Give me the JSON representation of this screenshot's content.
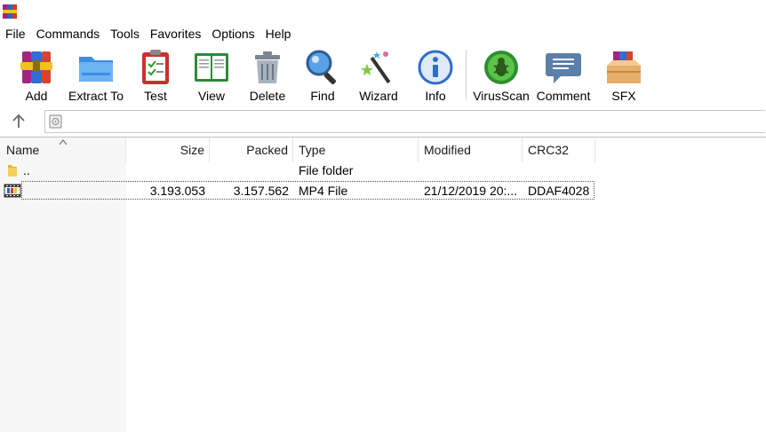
{
  "menu": [
    "File",
    "Commands",
    "Tools",
    "Favorites",
    "Options",
    "Help"
  ],
  "toolbar": [
    {
      "label": "Add",
      "icon": "add-archive-icon"
    },
    {
      "label": "Extract To",
      "icon": "extract-folder-icon"
    },
    {
      "label": "Test",
      "icon": "test-clipboard-icon"
    },
    {
      "label": "View",
      "icon": "view-book-icon"
    },
    {
      "label": "Delete",
      "icon": "trash-icon"
    },
    {
      "label": "Find",
      "icon": "magnifier-icon"
    },
    {
      "label": "Wizard",
      "icon": "magic-wand-icon"
    },
    {
      "label": "Info",
      "icon": "info-icon"
    },
    {
      "label": "VirusScan",
      "icon": "virus-scan-icon"
    },
    {
      "label": "Comment",
      "icon": "comment-bubble-icon"
    },
    {
      "label": "SFX",
      "icon": "sfx-box-icon"
    }
  ],
  "address": {
    "value": ""
  },
  "columns": {
    "name": "Name",
    "size": "Size",
    "packed": "Packed",
    "type": "Type",
    "modified": "Modified",
    "crc": "CRC32"
  },
  "rows": [
    {
      "name": "..",
      "size": "",
      "packed": "",
      "type": "File folder",
      "modified": "",
      "crc": "",
      "icon": "folder-icon"
    },
    {
      "name": "",
      "size": "3.193.053",
      "packed": "3.157.562",
      "type": "MP4 File",
      "modified": "21/12/2019 20:...",
      "crc": "DDAF4028",
      "icon": "video-file-icon"
    }
  ]
}
